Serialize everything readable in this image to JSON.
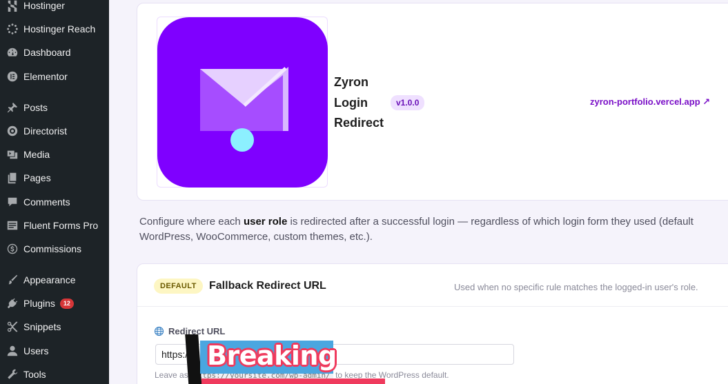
{
  "sidebar": {
    "items": [
      {
        "label": "Hostinger",
        "icon": "hostinger-icon"
      },
      {
        "label": "Hostinger Reach",
        "icon": "loader-icon"
      },
      {
        "label": "Dashboard",
        "icon": "dashboard-gauge-icon"
      },
      {
        "label": "Elementor",
        "icon": "elementor-icon"
      },
      {
        "label": "Posts",
        "icon": "pin-icon"
      },
      {
        "label": "Directorist",
        "icon": "directorist-icon"
      },
      {
        "label": "Media",
        "icon": "media-icon"
      },
      {
        "label": "Pages",
        "icon": "pages-icon"
      },
      {
        "label": "Comments",
        "icon": "comment-icon"
      },
      {
        "label": "Fluent Forms Pro",
        "icon": "forms-icon"
      },
      {
        "label": "Commissions",
        "icon": "dollar-icon"
      },
      {
        "label": "Appearance",
        "icon": "brush-icon"
      },
      {
        "label": "Plugins",
        "icon": "plugin-icon",
        "badge": "12"
      },
      {
        "label": "Snippets",
        "icon": "scissors-icon"
      },
      {
        "label": "Users",
        "icon": "user-icon"
      },
      {
        "label": "Tools",
        "icon": "wrench-icon"
      }
    ]
  },
  "plugin": {
    "name": "Zyron Login Redirect",
    "version": "v1.0.0",
    "link": "zyron-portfolio.vercel.app ↗",
    "logo_icon": "envelope-pin-icon",
    "logo_color": "#7f00ff"
  },
  "description": {
    "before": "Configure where each ",
    "bold": "user role",
    "after": " is redirected after a successful login — regardless of which login form they used (default WordPress, WooCommerce, custom themes, etc.)."
  },
  "fallback": {
    "pill": "DEFAULT",
    "title": "Fallback Redirect URL",
    "hint": "Used when no specific rule matches the logged-in user's role.",
    "field_label": "Redirect URL",
    "field_icon": "globe-icon",
    "input_value": "https://",
    "help_before": "Leave as ",
    "help_code": "https://yoursite.com/wp-admin/",
    "help_after": " to keep the WordPress default."
  },
  "overlay": {
    "text": "Breaking"
  }
}
